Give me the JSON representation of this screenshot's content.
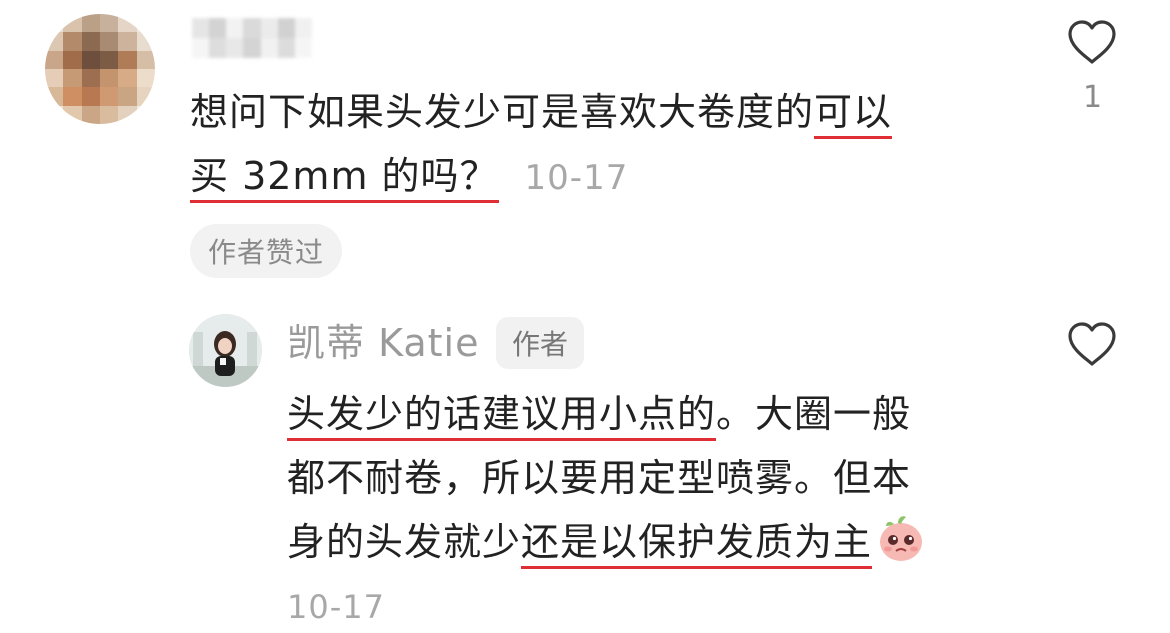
{
  "comment": {
    "text_line1_plain": "想问下如果头发少可是喜欢大卷度的",
    "text_line1_underlined": "可以",
    "text_line2_underlined": "买 32mm 的吗？",
    "timestamp": "10-17",
    "author_liked": "作者赞过",
    "like_count": "1",
    "heart_icon": "heart-outline-icon"
  },
  "reply": {
    "author_name": "凯蒂 Katie",
    "author_badge": "作者",
    "line1_underlined": "头发少的话建议用小点的",
    "line1_plain": "。大圈一般",
    "line2_plain": "都不耐卷，所以要用定型喷雾。但本",
    "line3_plain": "身的头发就少",
    "line3_underlined": "还是以保护发质为主",
    "emoji": "crying-peach-emoji",
    "timestamp": "10-17",
    "heart_icon": "heart-outline-icon"
  },
  "colors": {
    "underline": "#e02e36",
    "muted_text": "#a8a8a8",
    "pill_bg": "#f2f2f2"
  }
}
